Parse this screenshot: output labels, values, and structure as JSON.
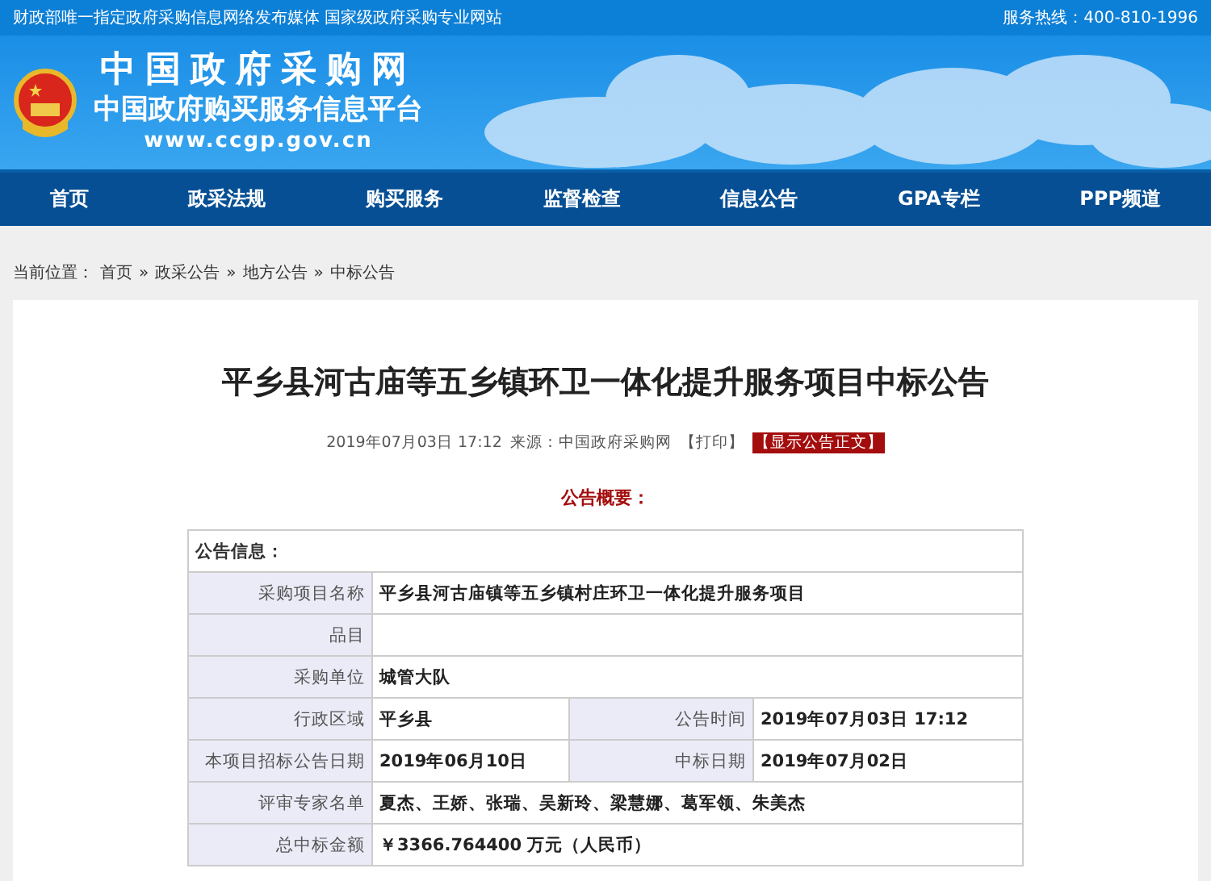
{
  "top_bar": {
    "tagline": "财政部唯一指定政府采购信息网络发布媒体 国家级政府采购专业网站",
    "hotline": "服务热线：400-810-1996"
  },
  "banner": {
    "title": "中国政府采购网",
    "subtitle": "中国政府购买服务信息平台",
    "url": "www.ccgp.gov.cn"
  },
  "nav": [
    "首页",
    "政采法规",
    "购买服务",
    "监督检查",
    "信息公告",
    "GPA专栏",
    "PPP频道"
  ],
  "breadcrumb": {
    "label": "当前位置：",
    "items": [
      {
        "text": "首页",
        "sep": "»"
      },
      {
        "text": "政采公告",
        "sep": "»"
      },
      {
        "text": "地方公告",
        "sep": "»"
      },
      {
        "text": "中标公告"
      }
    ]
  },
  "article": {
    "title": "平乡县河古庙等五乡镇环卫一体化提升服务项目中标公告",
    "date": "2019年07月03日 17:12",
    "source": "来源：中国政府采购网",
    "print": "【打印】",
    "show_body": "【显示公告正文】",
    "summary_heading": "公告概要：",
    "table": {
      "heading": "公告信息：",
      "rows": [
        {
          "pairs": [
            {
              "label": "采购项目名称",
              "value": "平乡县河古庙镇等五乡镇村庄环卫一体化提升服务项目"
            }
          ]
        },
        {
          "pairs": [
            {
              "label": "品目"
            }
          ]
        },
        {
          "pairs": [
            {
              "label": "采购单位",
              "value": "城管大队"
            }
          ]
        },
        {
          "pairs": [
            {
              "label": "行政区域",
              "value": "平乡县"
            },
            {
              "label": "公告时间",
              "value": "2019年07月03日 17:12"
            }
          ]
        },
        {
          "pairs": [
            {
              "label": "本项目招标公告日期",
              "value": "2019年06月10日"
            },
            {
              "label": "中标日期",
              "value": "2019年07月02日"
            }
          ]
        },
        {
          "pairs": [
            {
              "label": "评审专家名单",
              "value": "夏杰、王娇、张瑞、吴新玲、梁慧娜、葛军领、朱美杰"
            }
          ]
        },
        {
          "pairs": [
            {
              "label": "总中标金额",
              "value": "￥3366.764400 万元（人民币）"
            }
          ]
        }
      ]
    }
  }
}
